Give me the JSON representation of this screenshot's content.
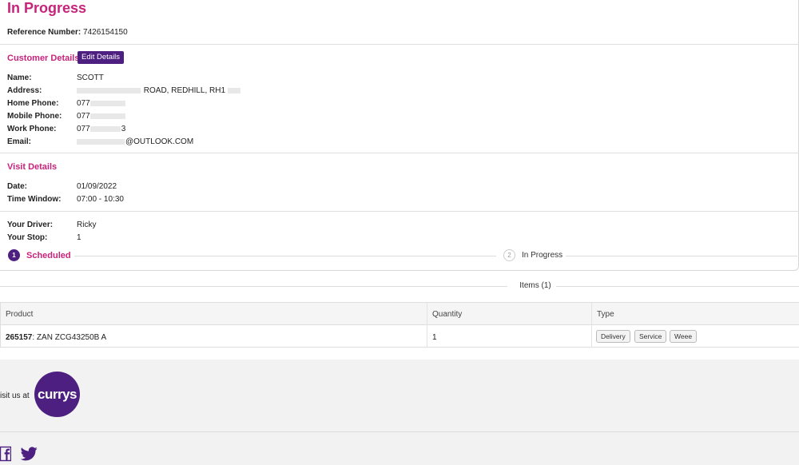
{
  "page": {
    "title": "In Progress",
    "reference_label": "Reference Number:",
    "reference_value": "7426154150"
  },
  "customer": {
    "section_title": "Customer Details",
    "edit_label": "Edit Details",
    "name_label": "Name:",
    "name_value": "SCOTT",
    "address_label": "Address:",
    "address_value_visible": "ROAD, REDHILL, RH1",
    "home_phone_label": "Home Phone:",
    "home_phone_visible": "077",
    "mobile_phone_label": "Mobile Phone:",
    "mobile_phone_visible": "077",
    "work_phone_label": "Work Phone:",
    "work_phone_visible": "077",
    "work_phone_tail": "3",
    "email_label": "Email:",
    "email_value_visible": "@OUTLOOK.COM"
  },
  "visit": {
    "section_title": "Visit Details",
    "date_label": "Date:",
    "date_value": "01/09/2022",
    "window_label": "Time Window:",
    "window_value": "07:00 - 10:30",
    "driver_label": "Your Driver:",
    "driver_value": "Ricky",
    "stop_label": "Your Stop:",
    "stop_value": "1"
  },
  "progress": {
    "step1_number": "1",
    "step1_label": "Scheduled",
    "step2_number": "2",
    "step2_label": "In Progress"
  },
  "items": {
    "heading": "Items (1)",
    "columns": [
      "Product",
      "Quantity",
      "Type"
    ],
    "rows": [
      {
        "product_code": "265157",
        "product_name": ": ZAN ZCG43250B A",
        "quantity": "1",
        "types": [
          "Delivery",
          "Service",
          "Weee"
        ]
      }
    ]
  },
  "footer": {
    "visit_text": "isit us at",
    "brand": "currys",
    "brand_color": "#4d1f80"
  },
  "colors": {
    "accent": "#c8237b",
    "primary": "#4d1f80"
  }
}
